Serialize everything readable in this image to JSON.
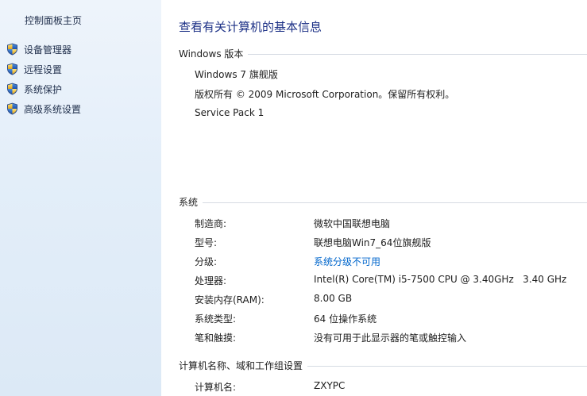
{
  "left_pane": {
    "home_link": "控制面板主页",
    "items": [
      {
        "label": "设备管理器",
        "icon": "uac-shield-icon"
      },
      {
        "label": "远程设置",
        "icon": "uac-shield-icon"
      },
      {
        "label": "系统保护",
        "icon": "uac-shield-icon"
      },
      {
        "label": "高级系统设置",
        "icon": "uac-shield-icon"
      }
    ]
  },
  "main": {
    "title": "查看有关计算机的基本信息",
    "windows_edition": {
      "header": "Windows 版本",
      "edition": "Windows 7 旗舰版",
      "copyright": "版权所有 © 2009 Microsoft Corporation。保留所有权利。",
      "service_pack": "Service Pack 1"
    },
    "system": {
      "header": "系统",
      "rows": [
        {
          "label": "制造商:",
          "value": "微软中国联想电脑"
        },
        {
          "label": "型号:",
          "value": "联想电脑Win7_64位旗舰版"
        },
        {
          "label": "分级:",
          "value": "系统分级不可用"
        },
        {
          "label": "处理器:",
          "value": "Intel(R) Core(TM) i5-7500 CPU @ 3.40GHz   3.40 GHz"
        },
        {
          "label": "安装内存(RAM):",
          "value": "8.00 GB"
        },
        {
          "label": "系统类型:",
          "value": "64 位操作系统"
        },
        {
          "label": "笔和触摸:",
          "value": "没有可用于此显示器的笔或触控输入"
        }
      ]
    },
    "computer_name": {
      "header": "计算机名称、域和工作组设置",
      "rows": [
        {
          "label": "计算机名:",
          "value": "ZXYPC"
        }
      ]
    }
  },
  "colors": {
    "title": "#1e3287",
    "link": "#0066cc",
    "pane_bg": "#e3eef9",
    "rule": "#d6dbe3"
  }
}
